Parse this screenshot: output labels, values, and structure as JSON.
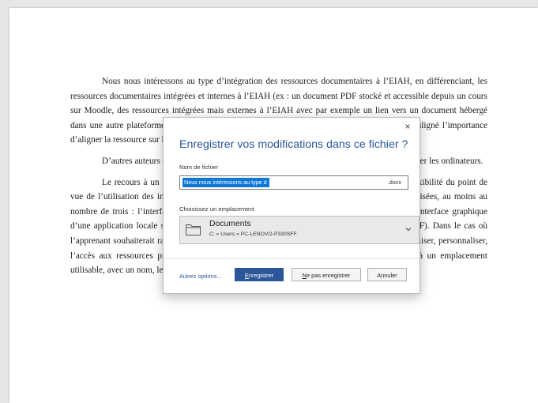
{
  "document": {
    "paragraphs": [
      "Nous nous intéressons au type d’intégration des ressources documentaires à l’EIAH, en différenciant, les ressources documentaires intégrées et internes à l’EIAH (ex : un document PDF stocké et accessible depuis un cours sur Moodle, des ressources intégrées mais externes à l’EIAH avec par exemple un lien vers un document hébergé dans une autre plateforme de stockage : Google drive. En effet, comme le montre (2015) a souligné l’importance d’aligner la ressource sur le contexte où il est utilisé, pour réaliser une tâche.",
      "D’autres auteurs ont étudié l’intégration des technologies, d’utiliser et d’apprendre à utiliser les ordinateurs.",
      "Le recours à un environnement, nécessite justement de la part de l’apprenant, de la flexibilité du point de vue de l’utilisation des interfaces graphiques, multiples et différenciés, qui vont devoir être utilisées, au moins au nombre de trois : l’interface graphique de Moodle, l’interface graphique de Google drive et l’interface graphique d’une application locale sous Windows ou OSX ou iOS (exemple un logiciel de lecture de PDF).  Dans le cas où l’apprenant souhaiterait rapatrier la ressource sur le disque dur de son ordinateur et ainsi, réorganiser, personnaliser, l’accès aux ressources proposées, il devra faire preuve de créativité pour créer un dossier, à un emplacement utilisable, avec un nom, le plus"
    ]
  },
  "dialog": {
    "close_glyph": "×",
    "title": "Enregistrer vos modifications dans ce fichier ?",
    "filename_label": "Nom de fichier",
    "filename_value": "Nous nous intéressons au type d",
    "filename_extension": ".docx",
    "location_label": "Choisissez un emplacement",
    "location_name": "Documents",
    "location_path": "C: » Users » PC-LENOVO-P330SFF",
    "more_options": "Autres options...",
    "save_label": "Enregistrer",
    "dont_save_label": "Ne pas enregistrer",
    "cancel_label": "Annuler"
  },
  "colors": {
    "accent": "#2b579a",
    "selection": "#0f78d7",
    "location_bg": "#e9e9e9"
  },
  "icons": {
    "close": "close-icon",
    "folder": "folder-icon",
    "dropdown": "chevron-down-icon"
  }
}
